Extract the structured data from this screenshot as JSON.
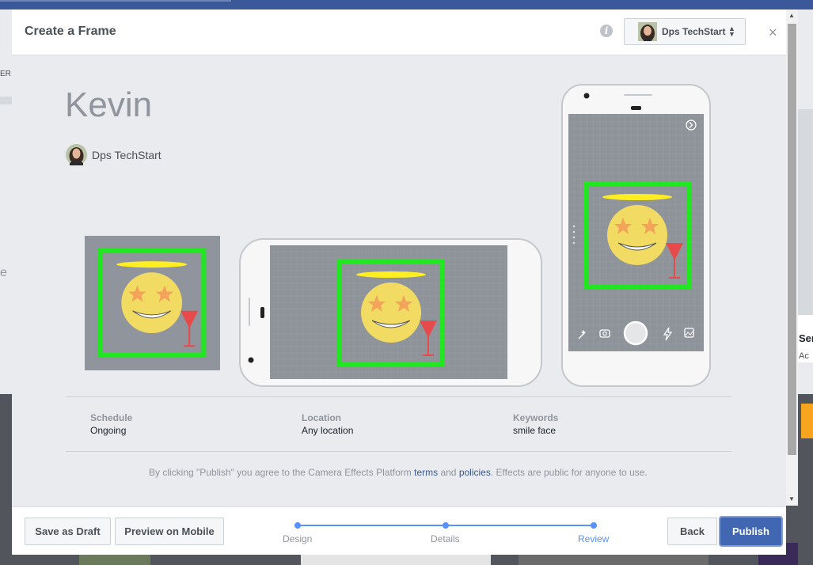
{
  "modal": {
    "title": "Create a Frame",
    "page_selector": {
      "name": "Dps TechStart"
    },
    "close_label": "×"
  },
  "effect": {
    "name": "Kevin",
    "owner": "Dps TechStart"
  },
  "details": {
    "schedule": {
      "label": "Schedule",
      "value": "Ongoing"
    },
    "location": {
      "label": "Location",
      "value": "Any location"
    },
    "keywords": {
      "label": "Keywords",
      "value": "smile face"
    }
  },
  "terms": {
    "before": "By clicking \"Publish\" you agree to the Camera Effects Platform ",
    "terms_link": "terms",
    "and": " and ",
    "policies_link": "policies",
    "after": ". Effects are public for anyone to use."
  },
  "footer": {
    "save_draft": "Save as Draft",
    "preview_mobile": "Preview on Mobile",
    "back": "Back",
    "publish": "Publish"
  },
  "steps": [
    {
      "label": "Design",
      "state": "done"
    },
    {
      "label": "Details",
      "state": "done"
    },
    {
      "label": "Review",
      "state": "active"
    }
  ],
  "background_page": {
    "left_fragment_top": "ER",
    "left_fragment_mid": "e",
    "right_fragment_top": "Sen",
    "right_fragment_sub": "Ac"
  },
  "colors": {
    "frame_green": "#22e622",
    "halo_yellow": "#ffee22",
    "face_yellow": "#f2db62",
    "star_orange": "#f4a35a",
    "glass_red": "#e74a4a",
    "primary_blue": "#4267b2",
    "step_blue": "#5890ff"
  },
  "icons": [
    "info-icon",
    "close-icon",
    "magic-wand-icon",
    "camera-flip-icon",
    "shutter-button-icon",
    "flash-icon",
    "gallery-icon",
    "forward-arrow-icon"
  ]
}
